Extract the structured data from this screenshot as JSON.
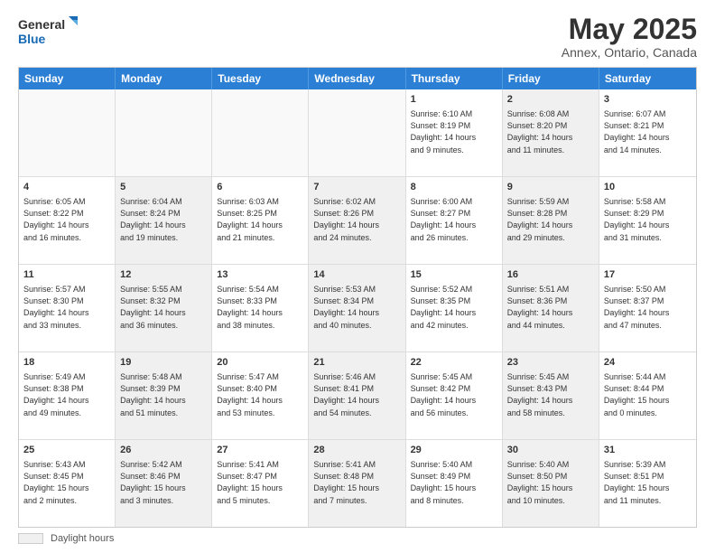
{
  "logo": {
    "line1": "General",
    "line2": "Blue"
  },
  "title": "May 2025",
  "subtitle": "Annex, Ontario, Canada",
  "days": [
    "Sunday",
    "Monday",
    "Tuesday",
    "Wednesday",
    "Thursday",
    "Friday",
    "Saturday"
  ],
  "footer": {
    "legend_label": "Daylight hours"
  },
  "weeks": [
    [
      {
        "day": "",
        "info": "",
        "empty": true
      },
      {
        "day": "",
        "info": "",
        "empty": true
      },
      {
        "day": "",
        "info": "",
        "empty": true
      },
      {
        "day": "",
        "info": "",
        "empty": true
      },
      {
        "day": "1",
        "info": "Sunrise: 6:10 AM\nSunset: 8:19 PM\nDaylight: 14 hours\nand 9 minutes.",
        "empty": false,
        "shaded": false
      },
      {
        "day": "2",
        "info": "Sunrise: 6:08 AM\nSunset: 8:20 PM\nDaylight: 14 hours\nand 11 minutes.",
        "empty": false,
        "shaded": true
      },
      {
        "day": "3",
        "info": "Sunrise: 6:07 AM\nSunset: 8:21 PM\nDaylight: 14 hours\nand 14 minutes.",
        "empty": false,
        "shaded": false
      }
    ],
    [
      {
        "day": "4",
        "info": "Sunrise: 6:05 AM\nSunset: 8:22 PM\nDaylight: 14 hours\nand 16 minutes.",
        "empty": false,
        "shaded": false
      },
      {
        "day": "5",
        "info": "Sunrise: 6:04 AM\nSunset: 8:24 PM\nDaylight: 14 hours\nand 19 minutes.",
        "empty": false,
        "shaded": true
      },
      {
        "day": "6",
        "info": "Sunrise: 6:03 AM\nSunset: 8:25 PM\nDaylight: 14 hours\nand 21 minutes.",
        "empty": false,
        "shaded": false
      },
      {
        "day": "7",
        "info": "Sunrise: 6:02 AM\nSunset: 8:26 PM\nDaylight: 14 hours\nand 24 minutes.",
        "empty": false,
        "shaded": true
      },
      {
        "day": "8",
        "info": "Sunrise: 6:00 AM\nSunset: 8:27 PM\nDaylight: 14 hours\nand 26 minutes.",
        "empty": false,
        "shaded": false
      },
      {
        "day": "9",
        "info": "Sunrise: 5:59 AM\nSunset: 8:28 PM\nDaylight: 14 hours\nand 29 minutes.",
        "empty": false,
        "shaded": true
      },
      {
        "day": "10",
        "info": "Sunrise: 5:58 AM\nSunset: 8:29 PM\nDaylight: 14 hours\nand 31 minutes.",
        "empty": false,
        "shaded": false
      }
    ],
    [
      {
        "day": "11",
        "info": "Sunrise: 5:57 AM\nSunset: 8:30 PM\nDaylight: 14 hours\nand 33 minutes.",
        "empty": false,
        "shaded": false
      },
      {
        "day": "12",
        "info": "Sunrise: 5:55 AM\nSunset: 8:32 PM\nDaylight: 14 hours\nand 36 minutes.",
        "empty": false,
        "shaded": true
      },
      {
        "day": "13",
        "info": "Sunrise: 5:54 AM\nSunset: 8:33 PM\nDaylight: 14 hours\nand 38 minutes.",
        "empty": false,
        "shaded": false
      },
      {
        "day": "14",
        "info": "Sunrise: 5:53 AM\nSunset: 8:34 PM\nDaylight: 14 hours\nand 40 minutes.",
        "empty": false,
        "shaded": true
      },
      {
        "day": "15",
        "info": "Sunrise: 5:52 AM\nSunset: 8:35 PM\nDaylight: 14 hours\nand 42 minutes.",
        "empty": false,
        "shaded": false
      },
      {
        "day": "16",
        "info": "Sunrise: 5:51 AM\nSunset: 8:36 PM\nDaylight: 14 hours\nand 44 minutes.",
        "empty": false,
        "shaded": true
      },
      {
        "day": "17",
        "info": "Sunrise: 5:50 AM\nSunset: 8:37 PM\nDaylight: 14 hours\nand 47 minutes.",
        "empty": false,
        "shaded": false
      }
    ],
    [
      {
        "day": "18",
        "info": "Sunrise: 5:49 AM\nSunset: 8:38 PM\nDaylight: 14 hours\nand 49 minutes.",
        "empty": false,
        "shaded": false
      },
      {
        "day": "19",
        "info": "Sunrise: 5:48 AM\nSunset: 8:39 PM\nDaylight: 14 hours\nand 51 minutes.",
        "empty": false,
        "shaded": true
      },
      {
        "day": "20",
        "info": "Sunrise: 5:47 AM\nSunset: 8:40 PM\nDaylight: 14 hours\nand 53 minutes.",
        "empty": false,
        "shaded": false
      },
      {
        "day": "21",
        "info": "Sunrise: 5:46 AM\nSunset: 8:41 PM\nDaylight: 14 hours\nand 54 minutes.",
        "empty": false,
        "shaded": true
      },
      {
        "day": "22",
        "info": "Sunrise: 5:45 AM\nSunset: 8:42 PM\nDaylight: 14 hours\nand 56 minutes.",
        "empty": false,
        "shaded": false
      },
      {
        "day": "23",
        "info": "Sunrise: 5:45 AM\nSunset: 8:43 PM\nDaylight: 14 hours\nand 58 minutes.",
        "empty": false,
        "shaded": true
      },
      {
        "day": "24",
        "info": "Sunrise: 5:44 AM\nSunset: 8:44 PM\nDaylight: 15 hours\nand 0 minutes.",
        "empty": false,
        "shaded": false
      }
    ],
    [
      {
        "day": "25",
        "info": "Sunrise: 5:43 AM\nSunset: 8:45 PM\nDaylight: 15 hours\nand 2 minutes.",
        "empty": false,
        "shaded": false
      },
      {
        "day": "26",
        "info": "Sunrise: 5:42 AM\nSunset: 8:46 PM\nDaylight: 15 hours\nand 3 minutes.",
        "empty": false,
        "shaded": true
      },
      {
        "day": "27",
        "info": "Sunrise: 5:41 AM\nSunset: 8:47 PM\nDaylight: 15 hours\nand 5 minutes.",
        "empty": false,
        "shaded": false
      },
      {
        "day": "28",
        "info": "Sunrise: 5:41 AM\nSunset: 8:48 PM\nDaylight: 15 hours\nand 7 minutes.",
        "empty": false,
        "shaded": true
      },
      {
        "day": "29",
        "info": "Sunrise: 5:40 AM\nSunset: 8:49 PM\nDaylight: 15 hours\nand 8 minutes.",
        "empty": false,
        "shaded": false
      },
      {
        "day": "30",
        "info": "Sunrise: 5:40 AM\nSunset: 8:50 PM\nDaylight: 15 hours\nand 10 minutes.",
        "empty": false,
        "shaded": true
      },
      {
        "day": "31",
        "info": "Sunrise: 5:39 AM\nSunset: 8:51 PM\nDaylight: 15 hours\nand 11 minutes.",
        "empty": false,
        "shaded": false
      }
    ]
  ]
}
